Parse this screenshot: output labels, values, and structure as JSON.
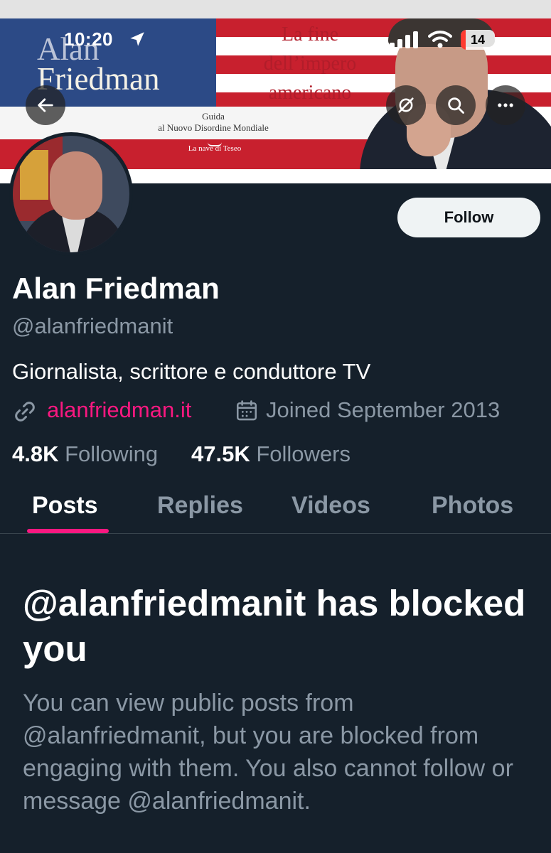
{
  "status_bar": {
    "time": "10:20",
    "battery": "14"
  },
  "banner": {
    "book_author_line1": "Alan",
    "book_author_line2": "Friedman",
    "book_title": [
      "La fine",
      "dell’impero",
      "americano"
    ],
    "book_subtitle_line1": "Guida",
    "book_subtitle_line2": "al Nuovo Disordine Mondiale",
    "publisher": "La nave di Teseo"
  },
  "header_actions": {
    "back": "back-arrow-icon",
    "grok": "grok-icon",
    "search": "search-icon",
    "more": "more-icon"
  },
  "profile": {
    "display_name": "Alan Friedman",
    "handle": "@alanfriedmanit",
    "bio": "Giornalista, scrittore e conduttore TV",
    "website": "alanfriedman.it",
    "joined": "Joined September 2013",
    "following_count": "4.8K",
    "following_label": "Following",
    "followers_count": "47.5K",
    "followers_label": "Followers",
    "follow_button": "Follow"
  },
  "tabs": [
    {
      "label": "Posts",
      "active": true
    },
    {
      "label": "Replies",
      "active": false
    },
    {
      "label": "Videos",
      "active": false
    },
    {
      "label": "Photos",
      "active": false
    }
  ],
  "blocked": {
    "title": "@alanfriedmanit has blocked you",
    "body": "You can view public posts from @alanfriedmanit, but you are blocked from engaging with them. You also cannot follow or message @alanfriedmanit."
  },
  "colors": {
    "background": "#15202b",
    "accent": "#f91880",
    "secondary_text": "#8b98a5",
    "primary_text": "#ffffff",
    "follow_button_bg": "#eff3f4"
  }
}
